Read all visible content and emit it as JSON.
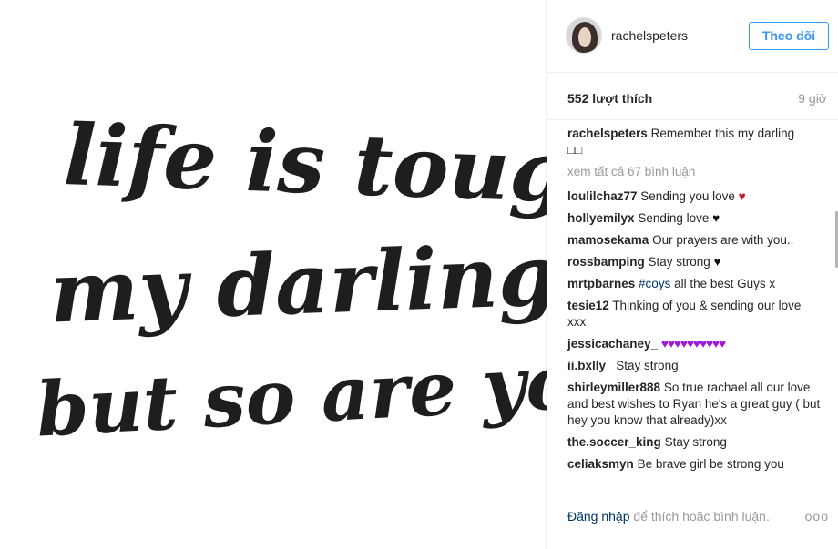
{
  "image": {
    "lines": [
      "life is tough",
      "my darling",
      "but so are you."
    ]
  },
  "header": {
    "username": "rachelspeters",
    "follow_label": "Theo dõi"
  },
  "meta": {
    "likes": "552 lượt thích",
    "time": "9 giờ"
  },
  "caption": {
    "user": "rachelspeters",
    "text": "Remember this my darling",
    "suffix": "□□"
  },
  "view_all": "xem tất cả 67 bình luận",
  "comments": [
    {
      "user": "loulilchaz77",
      "text": "Sending you love",
      "emoji": "♥"
    },
    {
      "user": "hollyemilyx",
      "text": "Sending love",
      "emoji": "♥"
    },
    {
      "user": "mamosekama",
      "text": "Our prayers are with you.."
    },
    {
      "user": "rossbamping",
      "text": "Stay strong",
      "emoji": "♥"
    },
    {
      "user": "mrtpbarnes",
      "tag": "#coys",
      "text": "all the best Guys x"
    },
    {
      "user": "tesie12",
      "text": "Thinking of you & sending our love xxx"
    },
    {
      "user": "jessicachaney_",
      "emoji": "♥♥♥♥♥♥♥♥♥♥"
    },
    {
      "user": "ii.bxlly_",
      "text": "Stay strong"
    },
    {
      "user": "shirleymiller888",
      "text": "So true rachael all our love and best wishes to Ryan he's a great guy ( but hey you know that already)xx"
    },
    {
      "user": "the.soccer_king",
      "text": "Stay strong"
    },
    {
      "user": "celiaksmyn",
      "text": "Be brave girl be strong you"
    }
  ],
  "footer": {
    "login_link": "Đăng nhập",
    "login_text": "để thích hoặc bình luận.",
    "more": "ooo"
  },
  "colors": {
    "accent": "#3897f0",
    "link": "#003569",
    "muted": "#999999",
    "heart_red": "#c01c28",
    "heart_purple": "#9b1bd6"
  },
  "icons": [
    "more-options-icon"
  ]
}
